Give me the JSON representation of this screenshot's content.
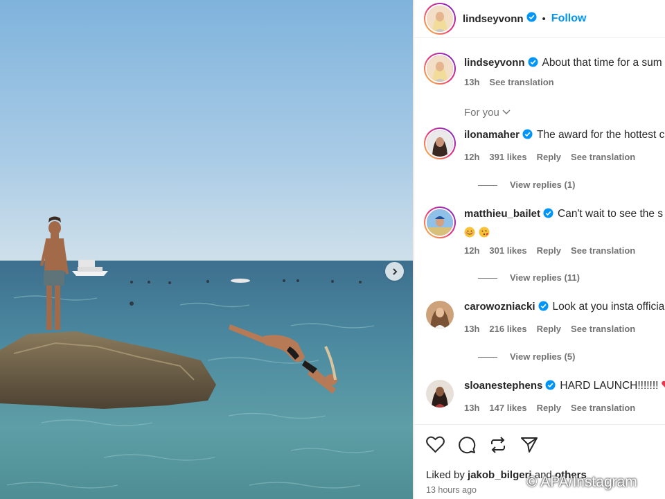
{
  "header": {
    "username": "lindseyvonn",
    "separator": "•",
    "follow_label": "Follow"
  },
  "caption": {
    "username": "lindseyvonn",
    "text": "About that time for a sum",
    "time": "13h",
    "see_translation": "See translation"
  },
  "sort_label": "For you",
  "comments": [
    {
      "username": "ilonamaher",
      "text": "The award for the hottest c",
      "time": "12h",
      "likes": "391 likes",
      "reply": "Reply",
      "see_translation": "See translation",
      "view_replies": "View replies (1)"
    },
    {
      "username": "matthieu_bailet",
      "text": "Can't wait to see the s",
      "time": "12h",
      "likes": "301 likes",
      "reply": "Reply",
      "see_translation": "See translation",
      "view_replies": "View replies (11)",
      "emojis": [
        "smiling-face-emoji",
        "kissing-face-emoji"
      ]
    },
    {
      "username": "carowozniacki",
      "text": "Look at you insta officia",
      "time": "13h",
      "likes": "216 likes",
      "reply": "Reply",
      "see_translation": "See translation",
      "view_replies": "View replies (5)"
    },
    {
      "username": "sloanestephens",
      "text": "HARD LAUNCH!!!!!!!",
      "time": "13h",
      "likes": "147 likes",
      "reply": "Reply",
      "see_translation": "See translation"
    }
  ],
  "likes_line": {
    "prefix": "Liked by ",
    "user": "jakob_bilgeri",
    "middle": " and ",
    "others": "others"
  },
  "posted_ago": "13 hours ago",
  "watermark": "© APA/Instagram",
  "icons": [
    "heart-icon",
    "comment-icon",
    "repost-icon",
    "share-icon",
    "verified-badge-icon",
    "chevron-right-icon",
    "chevron-down-icon"
  ],
  "colors": {
    "follow": "#0095f6",
    "verified": "#0095f6",
    "muted": "#737373"
  }
}
